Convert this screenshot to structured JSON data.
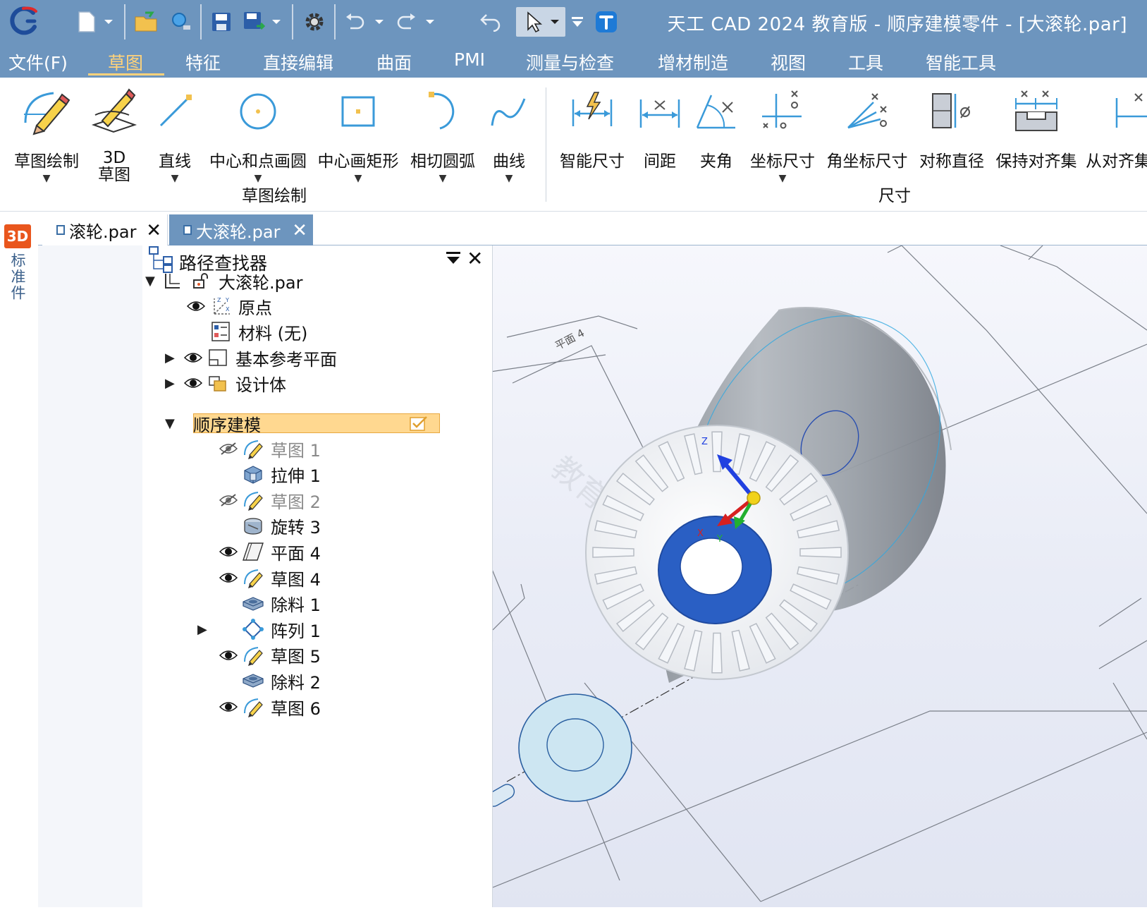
{
  "window": {
    "title": "天工 CAD 2024 教育版 - 顺序建模零件 - [大滚轮.par]"
  },
  "menu": {
    "items": [
      "文件(F)",
      "草图",
      "特征",
      "直接编辑",
      "曲面",
      "PMI",
      "测量与检查",
      "增材制造",
      "视图",
      "工具",
      "智能工具"
    ],
    "active": "草图"
  },
  "ribbon": {
    "sketch_group": {
      "label": "草图绘制",
      "buttons": [
        {
          "label": "草图绘制",
          "has_dropdown": true
        },
        {
          "label1": "3D",
          "label2": "草图",
          "has_dropdown": false
        },
        {
          "label": "直线",
          "has_dropdown": true
        },
        {
          "label": "中心和点画圆",
          "has_dropdown": true
        },
        {
          "label": "中心画矩形",
          "has_dropdown": true
        },
        {
          "label": "相切圆弧",
          "has_dropdown": true
        },
        {
          "label": "曲线",
          "has_dropdown": true
        }
      ]
    },
    "dimension_group": {
      "label": "尺寸",
      "buttons": [
        {
          "label": "智能尺寸"
        },
        {
          "label": "间距"
        },
        {
          "label": "夹角"
        },
        {
          "label": "坐标尺寸",
          "has_dropdown": true
        },
        {
          "label": "角坐标尺寸"
        },
        {
          "label": "对称直径"
        },
        {
          "label": "保持对齐集"
        },
        {
          "label": "从对齐集"
        }
      ]
    }
  },
  "tabs": [
    {
      "label": "滚轮.par",
      "active": false
    },
    {
      "label": "大滚轮.par",
      "active": true
    }
  ],
  "side_strip": {
    "badge": "3D",
    "label": "标准件"
  },
  "pathfinder": {
    "title": "路径查找器",
    "root": "大滚轮.par",
    "nodes": [
      {
        "label": "原点",
        "visible": true
      },
      {
        "label": "材料 (无)"
      },
      {
        "label": "基本参考平面",
        "visible": true,
        "expandable": true
      },
      {
        "label": "设计体",
        "visible": true,
        "expandable": true
      },
      {
        "label": "顺序建模",
        "selected": true,
        "expanded": true
      }
    ],
    "features": [
      {
        "label": "草图 1",
        "visibility": "hidden",
        "dim": true
      },
      {
        "label": "拉伸 1"
      },
      {
        "label": "草图 2",
        "visibility": "hidden",
        "dim": true
      },
      {
        "label": "旋转 3"
      },
      {
        "label": "平面 4",
        "visibility": "visible"
      },
      {
        "label": "草图 4",
        "visibility": "visible"
      },
      {
        "label": "除料 1"
      },
      {
        "label": "阵列 1",
        "expandable": true
      },
      {
        "label": "草图 5",
        "visibility": "visible"
      },
      {
        "label": "除料 2"
      },
      {
        "label": "草图 6",
        "visibility": "visible"
      }
    ]
  },
  "viewport": {
    "plane_label": "平面 4",
    "triad": {
      "x": "X",
      "y": "Y",
      "z": "Z"
    },
    "watermark": "教育"
  },
  "colors": {
    "titlebar": "#6d95be",
    "menu_active": "#ffd27a",
    "selection": "#ffd890",
    "hub_blue": "#2a5fc4",
    "axis_x": "#d62020",
    "axis_y": "#22b030",
    "axis_z": "#2040e0"
  }
}
